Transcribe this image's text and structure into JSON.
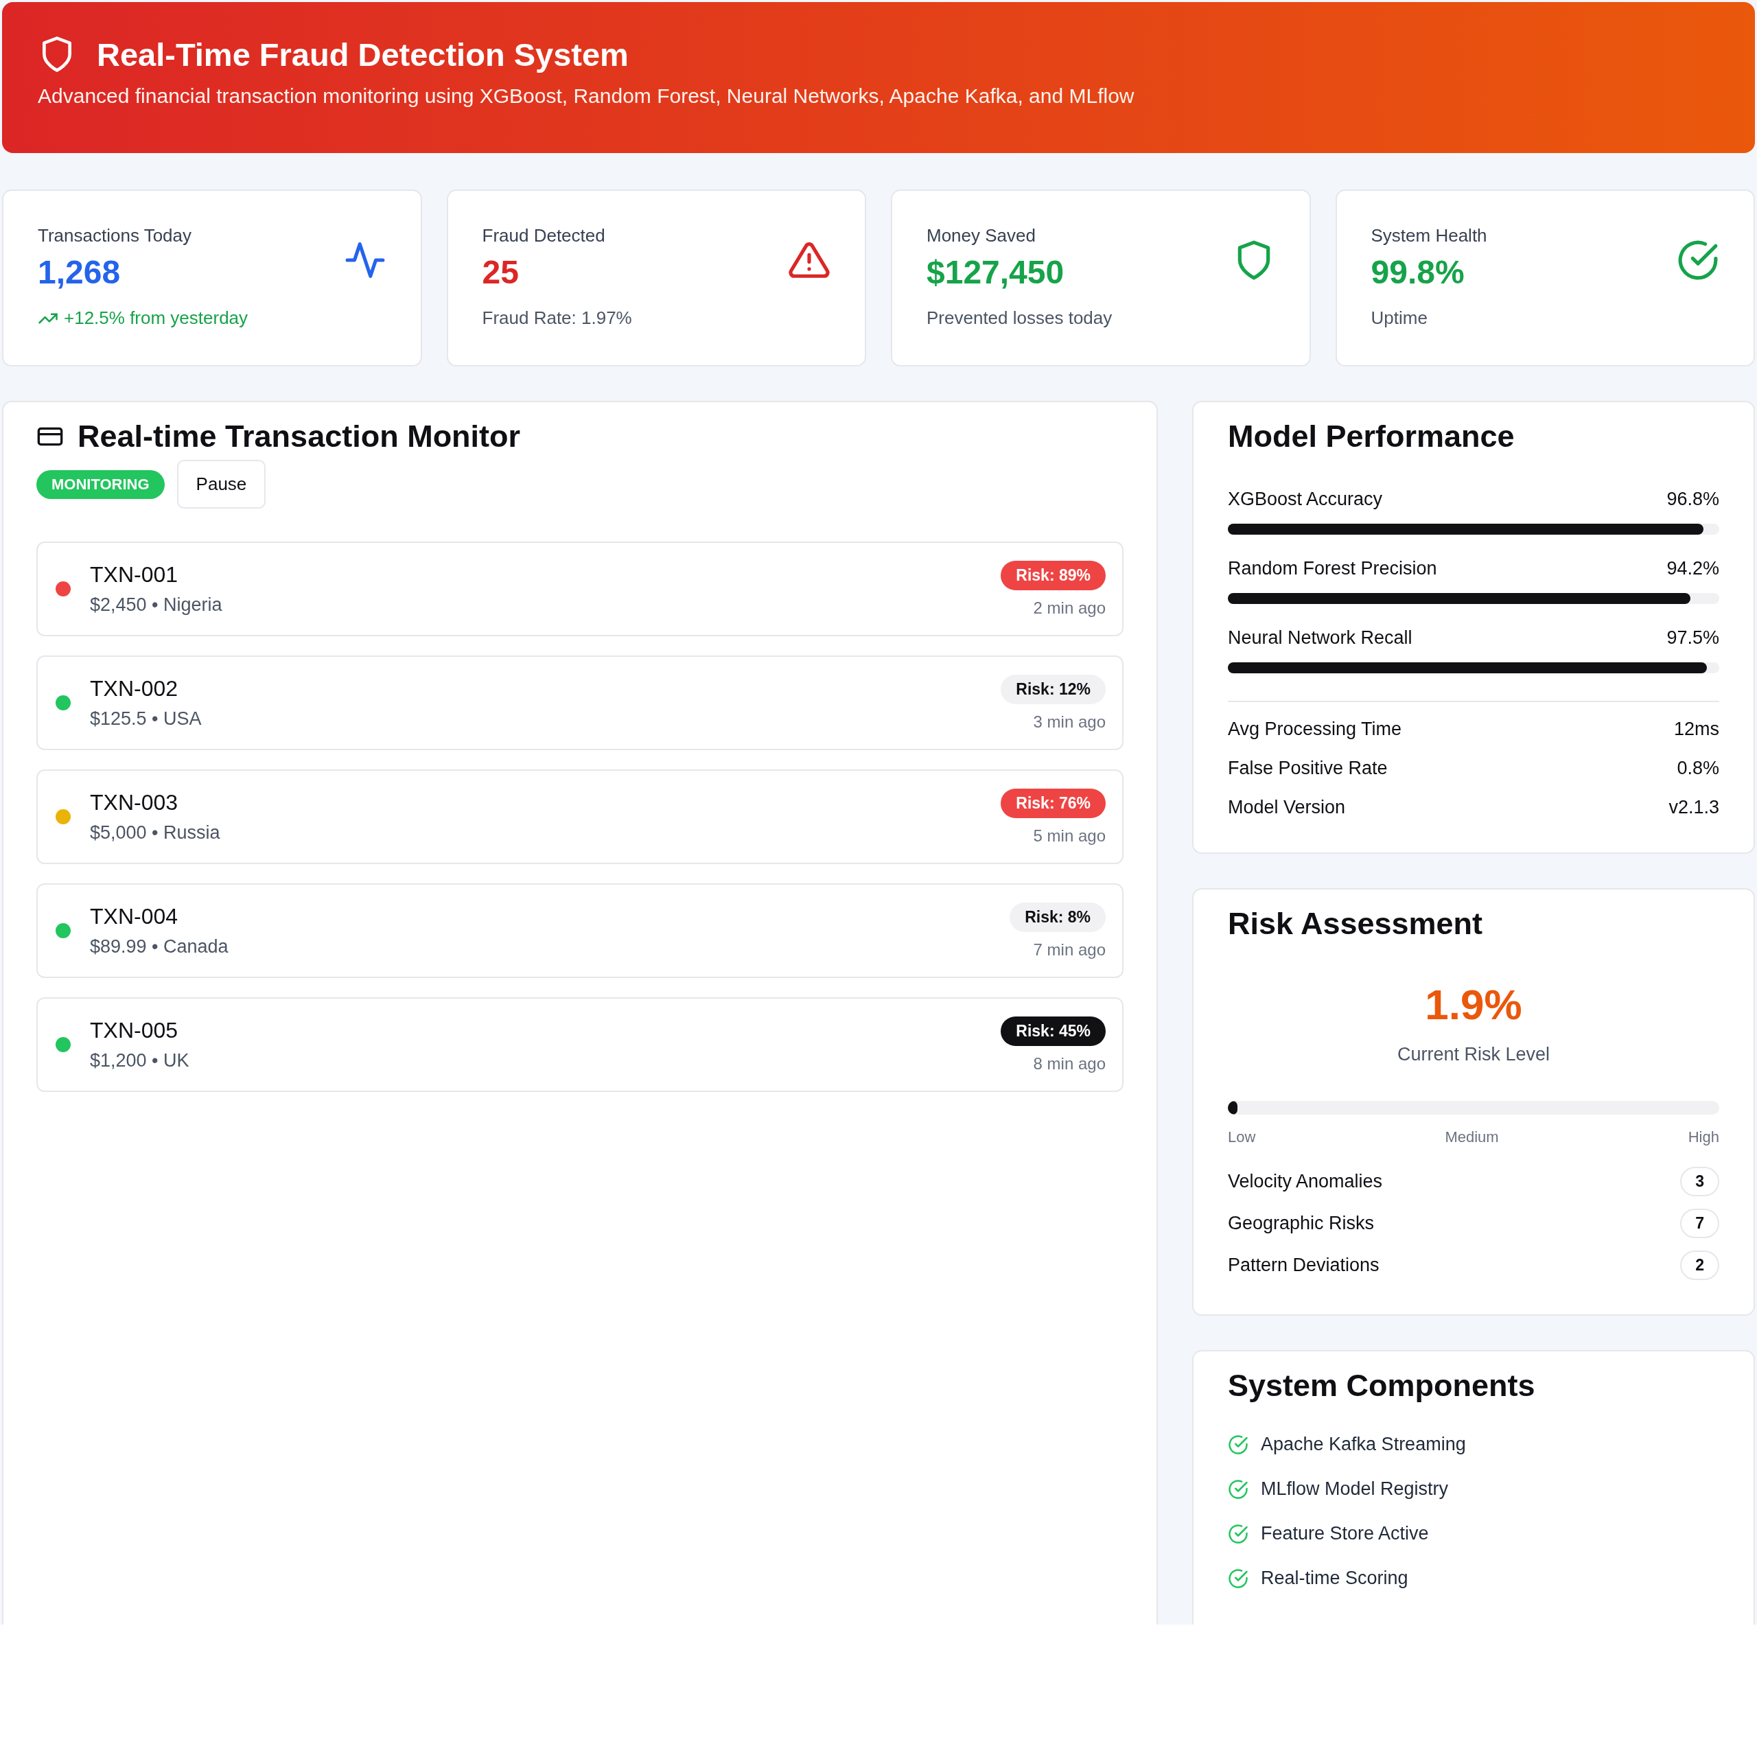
{
  "header": {
    "title": "Real-Time Fraud Detection System",
    "subtitle": "Advanced financial transaction monitoring using XGBoost, Random Forest, Neural Networks, Apache Kafka, and MLflow"
  },
  "stats": [
    {
      "kind": "activity",
      "label": "Transactions Today",
      "value": "1,268",
      "note": "+12.5% from yesterday"
    },
    {
      "kind": "alert",
      "label": "Fraud Detected",
      "value": "25",
      "note": "Fraud Rate: 1.97%"
    },
    {
      "kind": "shield",
      "label": "Money Saved",
      "value": "$127,450",
      "note": "Prevented losses today"
    },
    {
      "kind": "health",
      "label": "System Health",
      "value": "99.8%",
      "note": "Uptime"
    }
  ],
  "monitor": {
    "title": "Real-time Transaction Monitor",
    "status_badge": "MONITORING",
    "pause_button": "Pause",
    "transactions": [
      {
        "id": "TXN-001",
        "details": "$2,450 • Nigeria",
        "color": "#ef4444",
        "risk": "Risk: 89%",
        "kind": "high",
        "time": "2 min ago"
      },
      {
        "id": "TXN-002",
        "details": "$125.5 • USA",
        "color": "#22c55e",
        "risk": "Risk: 12%",
        "kind": "low",
        "time": "3 min ago"
      },
      {
        "id": "TXN-003",
        "details": "$5,000 • Russia",
        "color": "#eab308",
        "risk": "Risk: 76%",
        "kind": "high",
        "time": "5 min ago"
      },
      {
        "id": "TXN-004",
        "details": "$89.99 • Canada",
        "color": "#22c55e",
        "risk": "Risk: 8%",
        "kind": "low",
        "time": "7 min ago"
      },
      {
        "id": "TXN-005",
        "details": "$1,200 • UK",
        "color": "#22c55e",
        "risk": "Risk: 45%",
        "kind": "medium",
        "time": "8 min ago"
      }
    ]
  },
  "model_performance": {
    "title": "Model Performance",
    "metrics": [
      {
        "label": "XGBoost Accuracy",
        "value": "96.8%",
        "level": 0.968
      },
      {
        "label": "Random Forest Precision",
        "value": "94.2%",
        "level": 0.942
      },
      {
        "label": "Neural Network Recall",
        "value": "97.5%",
        "level": 0.975
      }
    ],
    "stats": [
      {
        "label": "Avg Processing Time",
        "value": "12ms"
      },
      {
        "label": "False Positive Rate",
        "value": "0.8%"
      },
      {
        "label": "Model Version",
        "value": "v2.1.3"
      }
    ]
  },
  "risk_assessment": {
    "title": "Risk Assessment",
    "value": "1.9%",
    "caption": "Current Risk Level",
    "level": 0.019,
    "scale": [
      "Low",
      "Medium",
      "High"
    ],
    "factors": [
      {
        "label": "Velocity Anomalies",
        "count": "3"
      },
      {
        "label": "Geographic Risks",
        "count": "7"
      },
      {
        "label": "Pattern Deviations",
        "count": "2"
      }
    ]
  },
  "system_components": {
    "title": "System Components",
    "items": [
      "Apache Kafka Streaming",
      "MLflow Model Registry",
      "Feature Store Active",
      "Real-time Scoring"
    ]
  }
}
